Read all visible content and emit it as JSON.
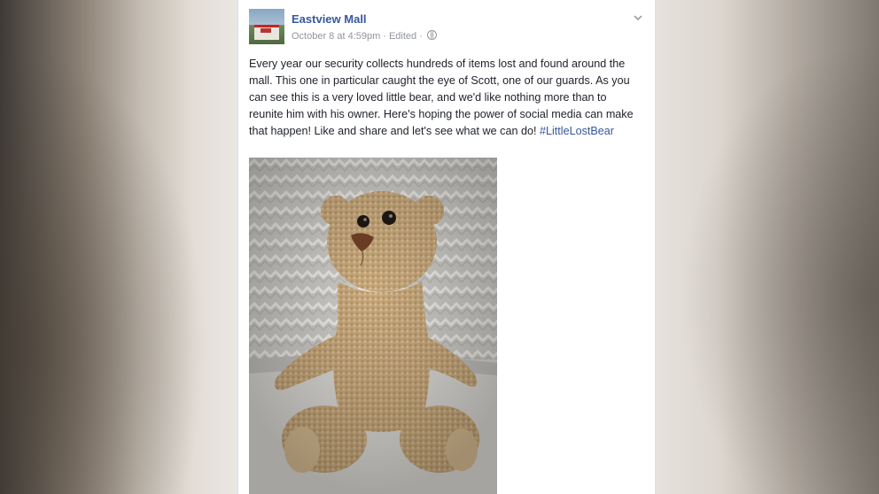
{
  "post": {
    "page_name": "Eastview Mall",
    "timestamp": "October 8 at 4:59pm",
    "edited": "Edited",
    "text": "Every year our security collects hundreds of items lost and found around the mall. This one in particular caught the eye of Scott, one of our guards. As you can see this is a very loved little bear, and we'd like nothing more than to reunite him with his owner. Here's hoping the power of social media can make that happen! Like and share and let's see what we can do! ",
    "hashtag": "#LittleLostBear",
    "options_icon": "chevron-down-icon",
    "privacy_icon": "globe-icon"
  },
  "colors": {
    "link_blue": "#365899",
    "meta_gray": "#90949c",
    "text": "#1d2129"
  }
}
